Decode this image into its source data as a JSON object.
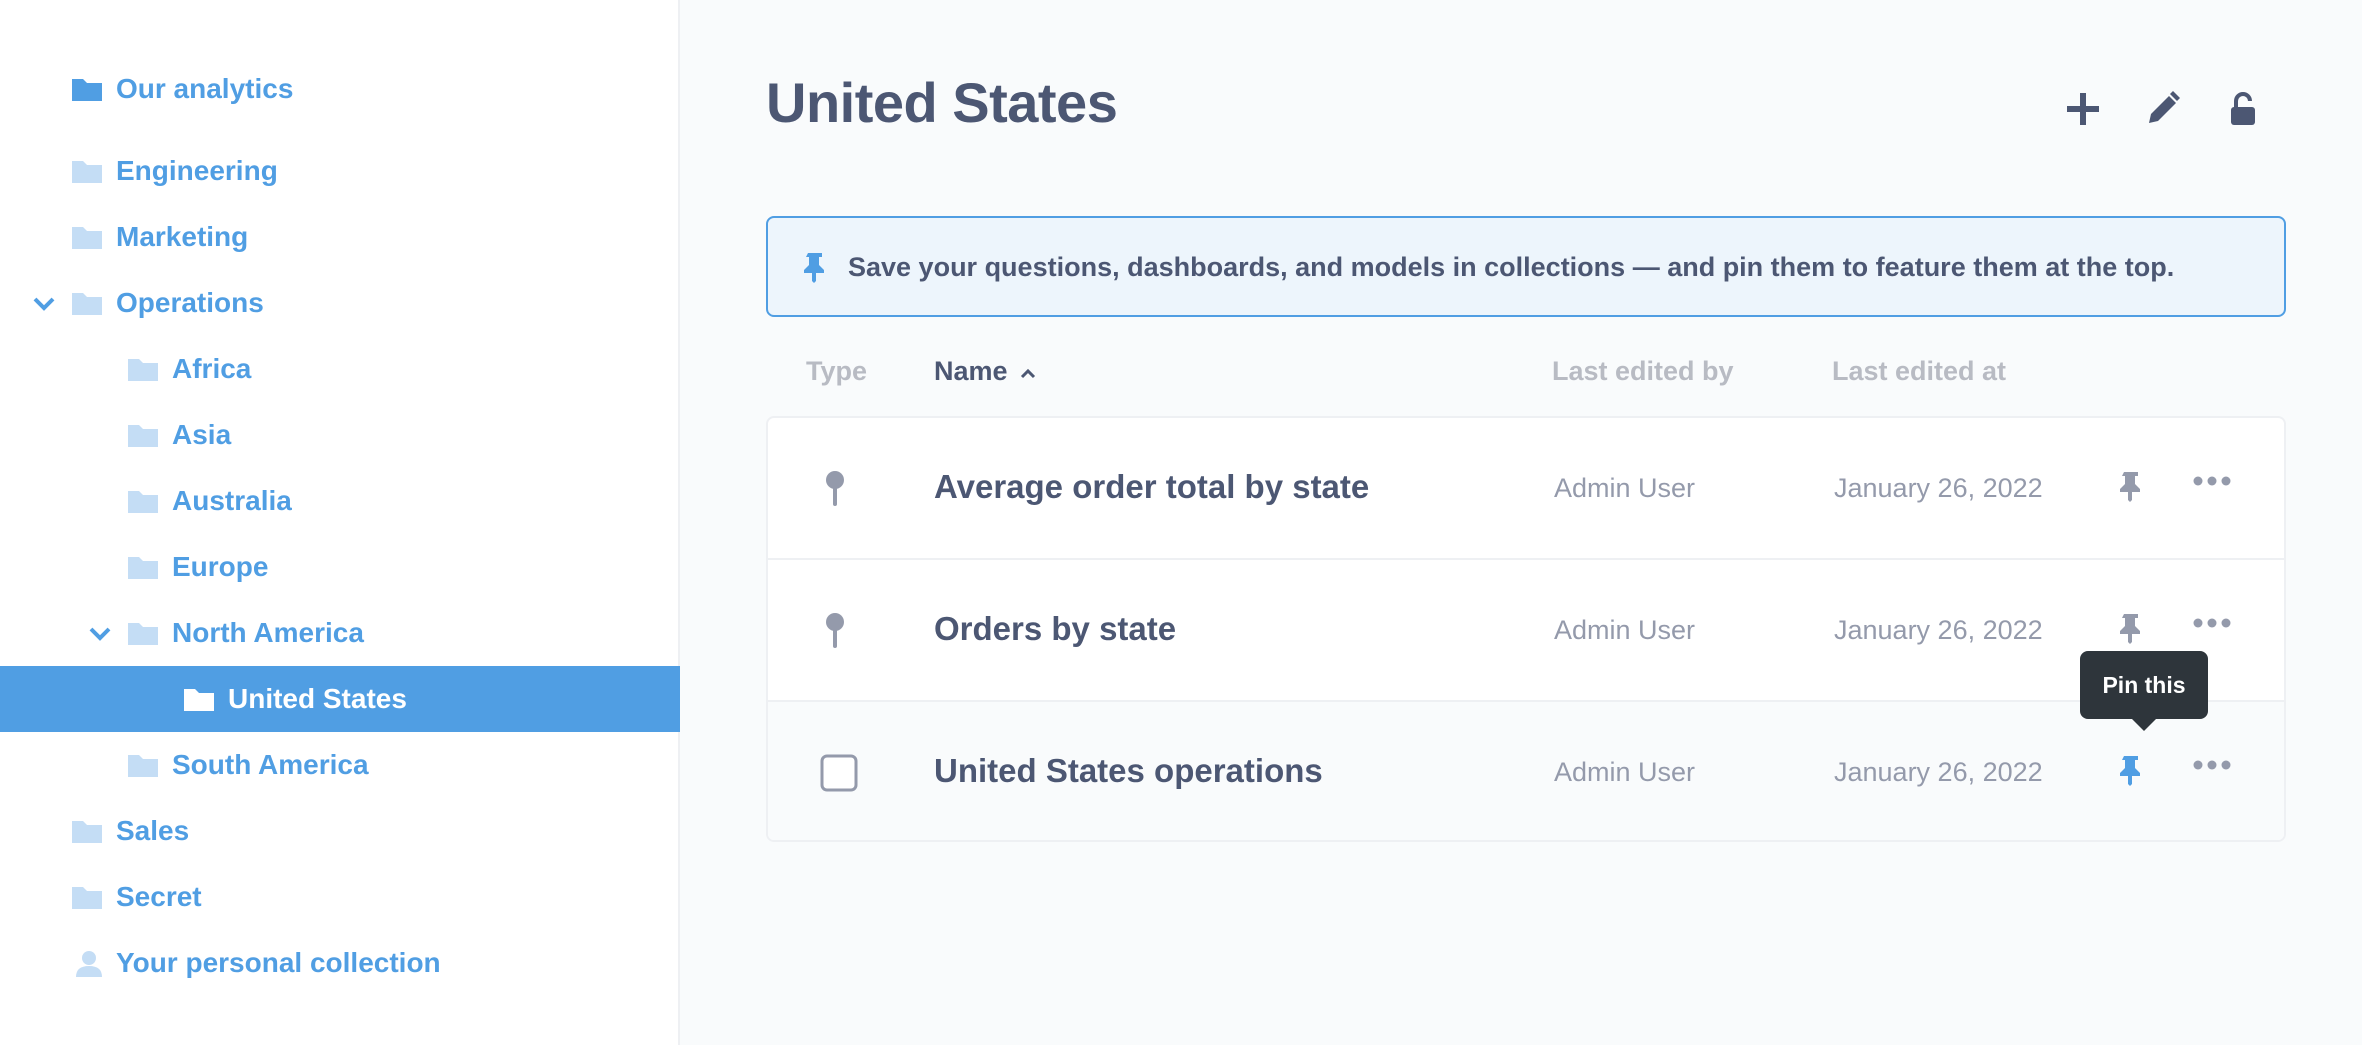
{
  "colors": {
    "brand": "#509ee3",
    "text_dark": "#4c5773",
    "text_light": "#949aab",
    "header_muted": "#b8bbc3",
    "tooltip_bg": "#2e353b"
  },
  "sidebar": {
    "items": [
      {
        "label": "Our analytics",
        "icon": "folder-icon",
        "selected": false,
        "expanded": false
      },
      {
        "label": "Engineering",
        "icon": "folder-icon",
        "selected": false,
        "expanded": false
      },
      {
        "label": "Marketing",
        "icon": "folder-icon",
        "selected": false,
        "expanded": false
      },
      {
        "label": "Operations",
        "icon": "folder-icon",
        "selected": false,
        "expanded": true
      },
      {
        "label": "Africa",
        "icon": "folder-icon",
        "selected": false,
        "expanded": false
      },
      {
        "label": "Asia",
        "icon": "folder-icon",
        "selected": false,
        "expanded": false
      },
      {
        "label": "Australia",
        "icon": "folder-icon",
        "selected": false,
        "expanded": false
      },
      {
        "label": "Europe",
        "icon": "folder-icon",
        "selected": false,
        "expanded": false
      },
      {
        "label": "North America",
        "icon": "folder-icon",
        "selected": false,
        "expanded": true
      },
      {
        "label": "United States",
        "icon": "folder-icon",
        "selected": true,
        "expanded": false
      },
      {
        "label": "South America",
        "icon": "folder-icon",
        "selected": false,
        "expanded": false
      },
      {
        "label": "Sales",
        "icon": "folder-icon",
        "selected": false,
        "expanded": false
      },
      {
        "label": "Secret",
        "icon": "folder-icon",
        "selected": false,
        "expanded": false
      },
      {
        "label": "Your personal collection",
        "icon": "person-icon",
        "selected": false,
        "expanded": false
      }
    ]
  },
  "header": {
    "title": "United States",
    "actions": [
      "add-icon",
      "pencil-icon",
      "lock-icon"
    ]
  },
  "banner": {
    "icon": "pin-icon",
    "text": "Save your questions, dashboards, and models in collections — and pin them to feature them at the top."
  },
  "table": {
    "columns": {
      "type": "Type",
      "name": "Name",
      "last_edited_by": "Last edited by",
      "last_edited_at": "Last edited at"
    },
    "sort": {
      "column": "Name",
      "direction": "ascending"
    },
    "rows": [
      {
        "type_icon": "map-pin-icon",
        "name": "Average order total by state",
        "last_edited_by": "Admin User",
        "last_edited_at": "January 26, 2022"
      },
      {
        "type_icon": "map-pin-icon",
        "name": "Orders by state",
        "last_edited_by": "Admin User",
        "last_edited_at": "January 26, 2022"
      },
      {
        "type_icon": "checkbox-icon",
        "name": "United States operations",
        "last_edited_by": "Admin User",
        "last_edited_at": "January 26, 2022"
      }
    ]
  },
  "tooltip": {
    "text": "Pin this"
  }
}
